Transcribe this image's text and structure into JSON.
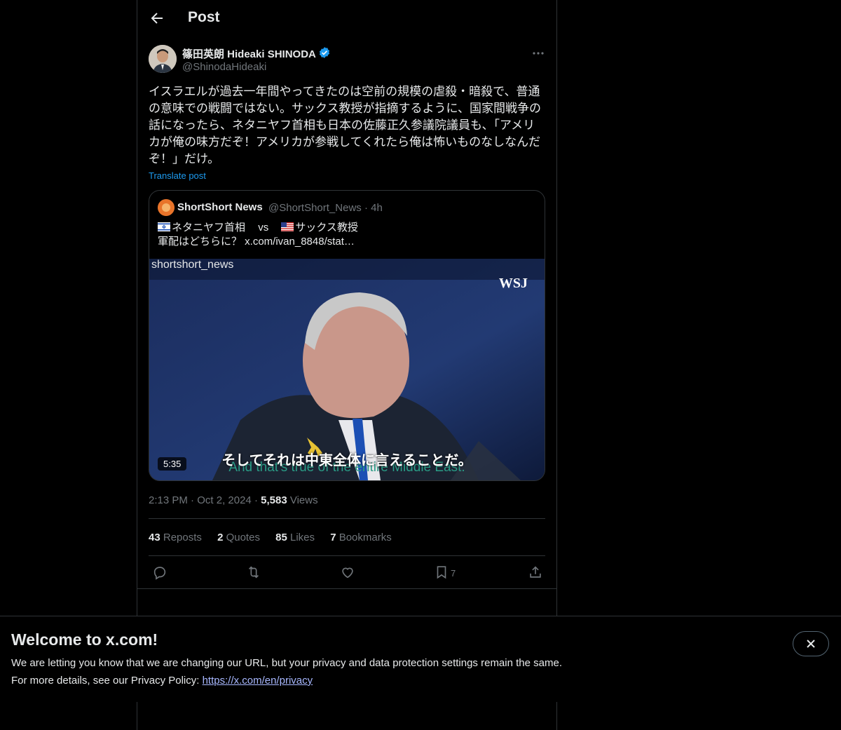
{
  "header": {
    "title": "Post"
  },
  "author": {
    "name": "篠田英朗 Hideaki SHINODA",
    "handle": "@ShinodaHideaki"
  },
  "tweet": {
    "text": "イスラエルが過去一年間やってきたのは空前の規模の虐殺・暗殺で、普通\nの意味での戦闘ではない。サックス教授が指摘するように、国家間戦争の\n話になったら、ネタニヤフ首相も日本の佐藤正久参議院議員も、「アメリ\nカが俺の味方だぞ！アメリカが参戦してくれたら俺は怖いものなしなんだ\nぞ！」だけ。",
    "translate_label": "Translate post"
  },
  "quote": {
    "name": "ShortShort News",
    "handle": "@ShortShort_News",
    "separator": "·",
    "time": "4h",
    "line1_a": "ネタニヤフ首相",
    "line1_vs": "vs",
    "line1_b": "サックス教授",
    "line2": "軍配はどちらに？  x.com/ivan_8848/stat…",
    "video": {
      "watermark": "shortshort_news",
      "logo": "WSJ",
      "subtitle_ja": "そしてそれは中東全体に言えることだ。",
      "subtitle_en": "And that's true of the entire Middle East.",
      "duration": "5:35"
    }
  },
  "meta": {
    "time": "2:13 PM",
    "sep": "·",
    "date": "Oct 2, 2024",
    "views_count": "5,583",
    "views_label": "Views"
  },
  "stats": {
    "reposts": "43",
    "reposts_label": "Reposts",
    "quotes": "2",
    "quotes_label": "Quotes",
    "likes": "85",
    "likes_label": "Likes",
    "bookmarks": "7",
    "bookmarks_label": "Bookmarks"
  },
  "actions": {
    "bookmark_count": "7"
  },
  "banner": {
    "title": "Welcome to x.com!",
    "line1": "We are letting you know that we are changing our URL, but your privacy and data protection settings remain the same.",
    "line2_prefix": "For more details, see our Privacy Policy: ",
    "link": "https://x.com/en/privacy"
  },
  "colors": {
    "accent": "#1d9bf0",
    "text": "#e7e9ea",
    "muted": "#71767b",
    "border": "#2f3336",
    "link": "#a8b8ff"
  },
  "icons": [
    "back-arrow-icon",
    "verified-badge-icon",
    "more-icon",
    "reply-icon",
    "repost-icon",
    "like-icon",
    "bookmark-icon",
    "share-icon",
    "close-icon",
    "israel-flag-icon",
    "us-flag-icon"
  ]
}
